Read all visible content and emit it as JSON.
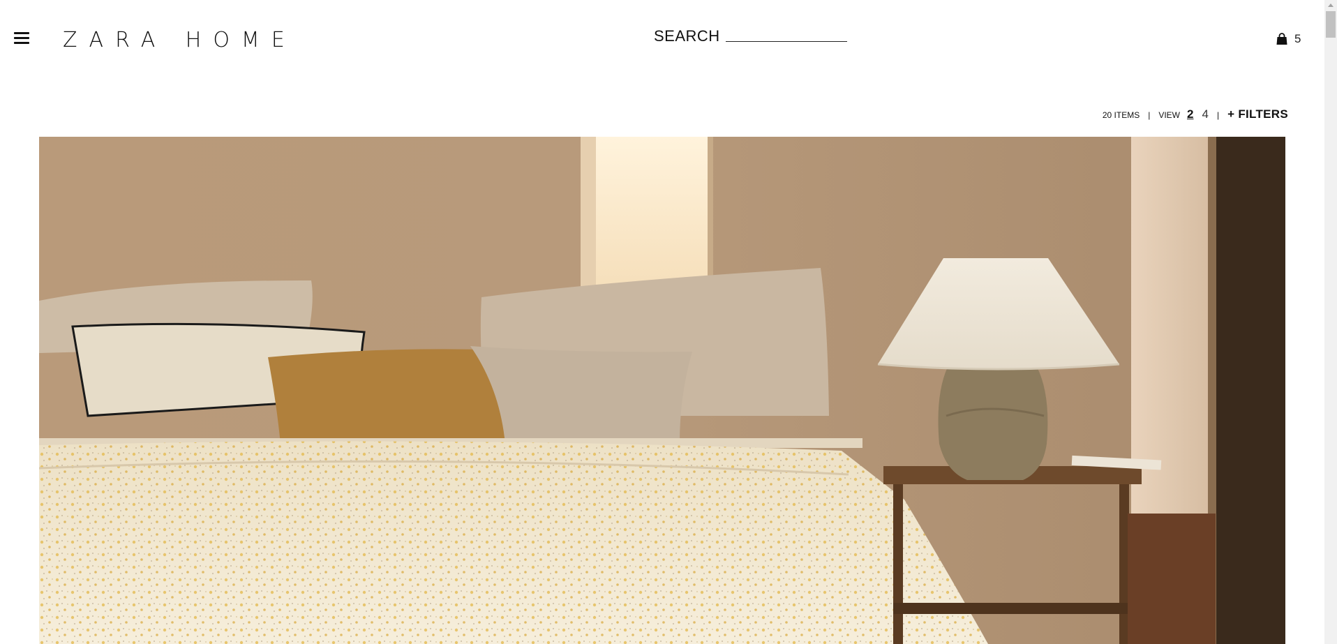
{
  "header": {
    "logo": "ZARA HOME",
    "search_label": "SEARCH",
    "cart_count": "5"
  },
  "toolbar": {
    "items_count": "20 ITEMS",
    "separator": "|",
    "view_label": "VIEW",
    "view_options": [
      "2",
      "4"
    ],
    "active_view": "2",
    "filters_label": "+ FILTERS"
  },
  "icons": {
    "menu": "hamburger-menu-icon",
    "cart": "shopping-bag-icon"
  },
  "hero": {
    "subject": "bedroom-with-floral-duvet-cushions-and-lamp"
  }
}
